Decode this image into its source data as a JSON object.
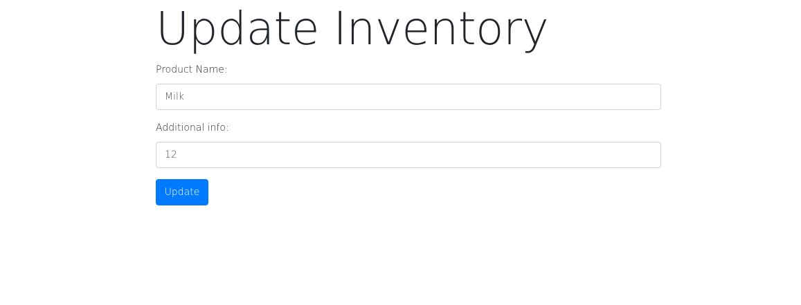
{
  "page": {
    "title": "Update Inventory"
  },
  "form": {
    "product_name": {
      "label": "Product Name:",
      "value": "Milk"
    },
    "additional_info": {
      "label": "Additional info:",
      "value": "12"
    },
    "submit_label": "Update"
  },
  "colors": {
    "primary": "#007bff",
    "text": "#212529",
    "input_border": "#ced4da"
  }
}
